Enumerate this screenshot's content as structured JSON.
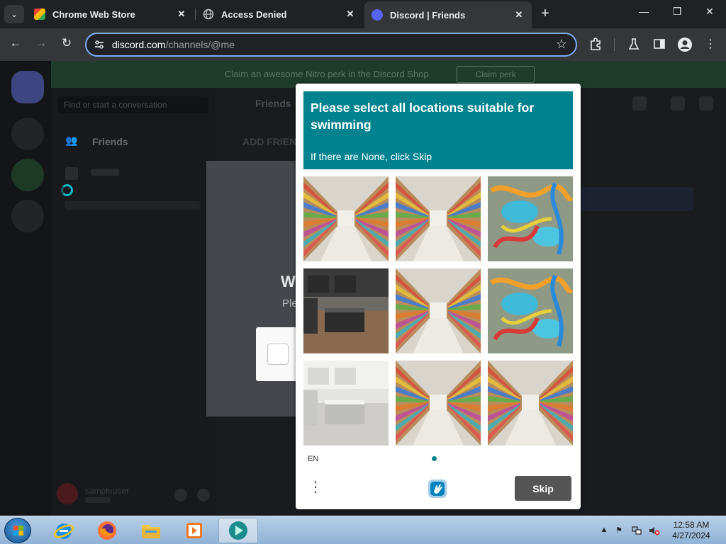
{
  "browser": {
    "tabs": [
      {
        "title": "Chrome Web Store",
        "active": false,
        "icon": "chrome-web-store-icon"
      },
      {
        "title": "Access Denied",
        "active": false,
        "icon": "globe-icon"
      },
      {
        "title": "Discord | Friends",
        "active": true,
        "icon": "discord-icon"
      }
    ],
    "url_host": "discord.com",
    "url_path": "/channels/@me"
  },
  "discord_background": {
    "banner_text": "Claim an awesome Nitro perk in the Discord Shop",
    "banner_button": "Claim perk",
    "search_placeholder": "Find or start a conversation",
    "friends_label": "Friends",
    "topbar_friends": "Friends",
    "add_friend": "ADD FRIEND",
    "username": "sampleuser"
  },
  "verify_modal": {
    "heading": "W",
    "subtext": "Ple"
  },
  "captcha": {
    "prompt": "Please select all locations suitable for swimming",
    "hint": "If there are None, click Skip",
    "language": "EN",
    "skip_label": "Skip",
    "accent_color": "#00838f",
    "tiles": [
      {
        "scene": "supermarket-aisle"
      },
      {
        "scene": "supermarket-aisle"
      },
      {
        "scene": "water-park"
      },
      {
        "scene": "kitchen"
      },
      {
        "scene": "supermarket-aisle"
      },
      {
        "scene": "water-park"
      },
      {
        "scene": "kitchen"
      },
      {
        "scene": "supermarket-aisle"
      },
      {
        "scene": "supermarket-aisle"
      }
    ]
  },
  "taskbar": {
    "apps": [
      "internet-explorer",
      "firefox",
      "file-explorer",
      "media-player",
      "active-app"
    ],
    "time": "12:58 AM",
    "date": "4/27/2024"
  }
}
